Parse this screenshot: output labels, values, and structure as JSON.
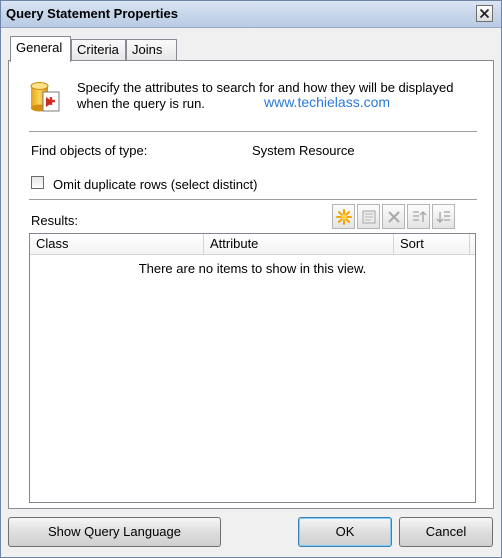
{
  "window": {
    "title": "Query Statement Properties"
  },
  "tabs": [
    {
      "label": "General",
      "active": true
    },
    {
      "label": "Criteria",
      "active": false
    },
    {
      "label": "Joins",
      "active": false
    }
  ],
  "general": {
    "intro_text": "Specify the attributes to search for and how they will be displayed when the query is run.",
    "watermark": "www.techielass.com",
    "find_label": "Find objects of type:",
    "find_value": "System Resource",
    "omit_duplicates_label": "Omit duplicate rows (select distinct)",
    "omit_duplicates_checked": false,
    "results_label": "Results:",
    "toolbar_icons": [
      "new-icon",
      "properties-icon",
      "delete-icon",
      "move-up-icon",
      "move-down-icon"
    ],
    "results_columns": [
      "Class",
      "Attribute",
      "Sort"
    ],
    "empty_message": "There are no items to show in this view."
  },
  "buttons": {
    "show_query_language": "Show Query Language",
    "ok": "OK",
    "cancel": "Cancel"
  }
}
